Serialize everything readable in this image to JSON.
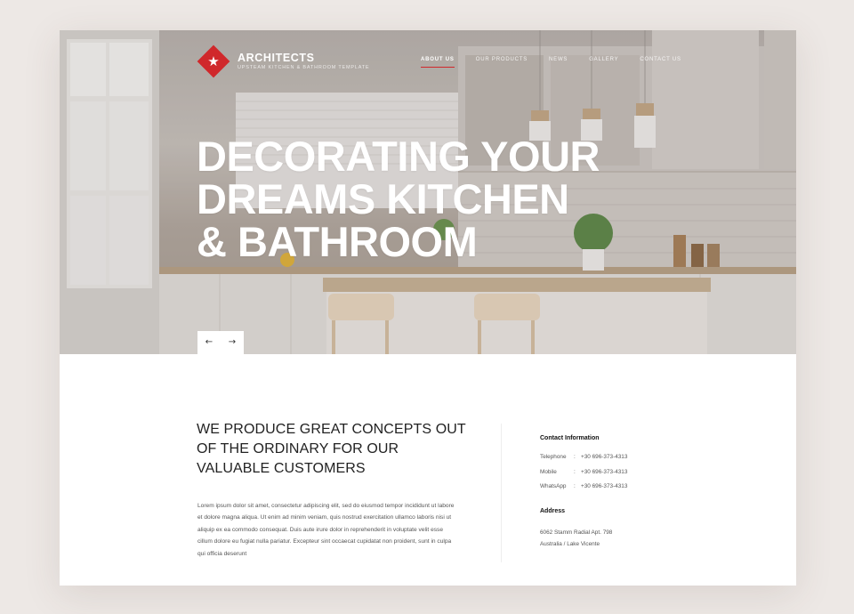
{
  "brand": {
    "name": "ARCHITECTS",
    "tagline": "UPSTEAM KITCHEN & BATHROOM TEMPLATE",
    "logo_color": "#d0282b"
  },
  "nav": {
    "items": [
      {
        "label": "ABOUT US",
        "active": true
      },
      {
        "label": "OUR PRODUCTS",
        "active": false
      },
      {
        "label": "NEWS",
        "active": false
      },
      {
        "label": "GALLERY",
        "active": false
      },
      {
        "label": "CONTACT US",
        "active": false
      }
    ]
  },
  "hero": {
    "headline": [
      "DECORATING YOUR",
      "DREAMS KITCHEN",
      "& BATHROOM"
    ],
    "prev_icon": "←",
    "next_icon": "→"
  },
  "intro": {
    "title": "WE PRODUCE GREAT CONCEPTS OUT OF THE ORDINARY FOR OUR VALUABLE CUSTOMERS",
    "body": "Lorem ipsum dolor sit amet, consectetur adipiscing elit, sed do eiusmod tempor incididunt ut labore et dolore magna aliqua. Ut enim ad minim veniam, quis nostrud exercitation ullamco laboris nisi ut aliquip ex ea commodo consequat. Duis aute irure dolor in reprehenderit in voluptate velit esse cillum dolore eu fugiat nulla pariatur. Excepteur sint occaecat cupidatat non proident, sunt in culpa qui officia deserunt"
  },
  "contact": {
    "heading": "Contact Information",
    "rows": [
      {
        "label": "Telephone",
        "sep": ":",
        "value": "+30 696-373-4313"
      },
      {
        "label": "Mobile",
        "sep": ":",
        "value": "+30 696-373-4313"
      },
      {
        "label": "WhatsApp",
        "sep": ":",
        "value": "+30 696-373-4313"
      }
    ]
  },
  "address": {
    "heading": "Address",
    "line1": "6062 Stamm Radial Apt. 798",
    "line2": "Australia   / Lake Vicente"
  }
}
